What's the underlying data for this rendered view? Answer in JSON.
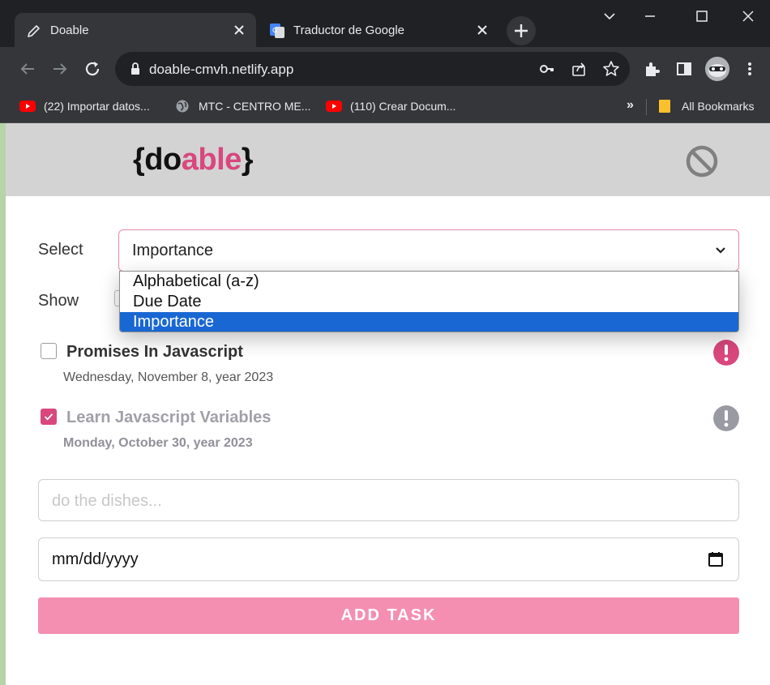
{
  "browser": {
    "tabs": [
      {
        "title": "Doable",
        "active": true
      },
      {
        "title": "Traductor de Google",
        "active": false
      }
    ],
    "url": "doable-cmvh.netlify.app",
    "bookmarks": [
      {
        "label": "(22) Importar datos..."
      },
      {
        "label": "MTC - CENTRO ME..."
      },
      {
        "label": "(110) Crear Docum..."
      }
    ],
    "bookmarks_overflow": "»",
    "all_bookmarks": "All Bookmarks"
  },
  "app": {
    "logo": {
      "open": "{",
      "do": "do",
      "able": "able",
      "close": "}"
    },
    "colors": {
      "accent": "#d9477d",
      "header_bg": "#d3d3d3",
      "button_bg": "#f48fb1"
    },
    "sort": {
      "label": "Select",
      "value": "Importance",
      "options": [
        "Alphabetical (a-z)",
        "Due Date",
        "Importance"
      ]
    },
    "show": {
      "label": "Show"
    },
    "tasks": [
      {
        "title": "Promises In Javascript",
        "date": "Wednesday, November 8, year 2023",
        "done": false
      },
      {
        "title": "Learn Javascript Variables",
        "date": "Monday, October 30, year 2023",
        "done": true
      }
    ],
    "task_input": {
      "placeholder": "do the dishes..."
    },
    "date_input": {
      "value": "mm/dd/yyyy"
    },
    "add_button": "ADD TASK"
  }
}
